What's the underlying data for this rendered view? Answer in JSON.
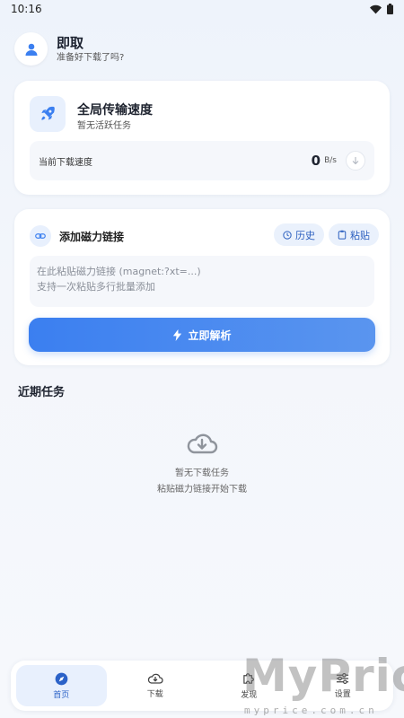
{
  "status_bar": {
    "time": "10:16"
  },
  "header": {
    "title": "即取",
    "subtitle": "准备好下载了吗?"
  },
  "speed_card": {
    "title": "全局传输速度",
    "subtitle": "暂无活跃任务",
    "current_label": "当前下载速度",
    "value": "0",
    "unit": "B/s"
  },
  "magnet_card": {
    "title": "添加磁力链接",
    "history_label": "历史",
    "paste_label": "粘贴",
    "placeholder": "在此粘贴磁力链接 (magnet:?xt=...)\n支持一次粘贴多行批量添加",
    "parse_label": "立即解析"
  },
  "recent": {
    "title": "近期任务",
    "empty_title": "暂无下载任务",
    "empty_hint": "粘贴磁力链接开始下载"
  },
  "nav": [
    {
      "label": "首页",
      "icon": "compass-icon"
    },
    {
      "label": "下载",
      "icon": "cloud-download-icon"
    },
    {
      "label": "发现",
      "icon": "puzzle-icon"
    },
    {
      "label": "设置",
      "icon": "sliders-icon"
    }
  ],
  "watermark": {
    "brand": "MyPrice",
    "site": "myprice.com.cn"
  },
  "colors": {
    "accent": "#3b7ff0",
    "accent_light": "#e8f0fd",
    "background": "#eef3fb"
  }
}
